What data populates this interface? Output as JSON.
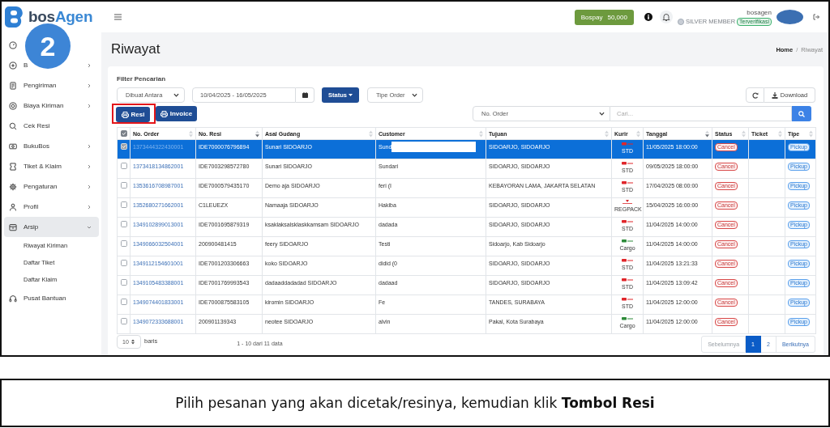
{
  "step_badge": "2",
  "header": {
    "brand": [
      "bos",
      "Agen"
    ],
    "wallet": {
      "label": "Bospay",
      "amount": "50,000"
    },
    "user": {
      "name": "bosagen",
      "tier": "SILVER MEMBER",
      "status": "Terverifikasi"
    }
  },
  "sidebar": {
    "items": [
      {
        "selected": false
      },
      {
        "label": "B",
        "expanded": false,
        "selected": false
      },
      {
        "label": "Pengiriman",
        "expanded": false,
        "selected": false
      },
      {
        "label": "Biaya Kiriman",
        "expanded": false,
        "selected": false
      },
      {
        "label": "Cek Resi",
        "selected": false
      },
      {
        "label": "BukuBos",
        "expanded": false,
        "selected": false
      },
      {
        "label": "Tiket & Klaim",
        "expanded": false,
        "selected": false
      },
      {
        "label": "Pengaturan",
        "expanded": false,
        "selected": false
      },
      {
        "label": "Profil",
        "expanded": false,
        "selected": false
      },
      {
        "label": "Arsip",
        "expanded": true,
        "selected": true,
        "children": [
          {
            "label": "Riwayat Kiriman",
            "selected": false
          },
          {
            "label": "Daftar Tiket",
            "selected": false
          },
          {
            "label": "Daftar Klaim",
            "selected": false
          }
        ]
      },
      {
        "label": "Pusat Bantuan",
        "selected": false
      }
    ]
  },
  "page": {
    "title": "Riwayat",
    "breadcrumb": {
      "separator": "/",
      "items": [
        {
          "label": "Home",
          "kind": "link"
        },
        {
          "label": "Riwayat",
          "kind": "current"
        }
      ]
    }
  },
  "filters": {
    "title": "Filter Pencarian",
    "date_basis": "Dibuat Antara",
    "date_range": "10/04/2025 - 16/05/2025",
    "status_button": "Status",
    "order_type": "Tipe Order",
    "download": "Download"
  },
  "print_buttons": [
    {
      "label": "Resi",
      "highlighted": true
    },
    {
      "label": "Invoice",
      "highlighted": false
    }
  ],
  "search": {
    "field": "No. Order",
    "placeholder": "Cari..."
  },
  "table": {
    "all_checked": true,
    "columns": [
      {
        "label": "No. Order",
        "sorted": false
      },
      {
        "label": "No. Resi",
        "sorted": true
      },
      {
        "label": "Asal Gudang",
        "sorted": false
      },
      {
        "label": "Customer",
        "sorted": false
      },
      {
        "label": "Tujuan",
        "sorted": false
      },
      {
        "label": "Kurir",
        "sorted": false
      },
      {
        "label": "Tanggal",
        "sorted": true
      },
      {
        "label": "Status",
        "sorted": false
      },
      {
        "label": "Ticket",
        "sorted": false
      },
      {
        "label": "Tipe",
        "sorted": false
      }
    ],
    "rows": [
      {
        "selected": true,
        "checked": true,
        "order_no": "1373444322430001",
        "resi": "IDE7000076796894",
        "origin": "Sunari SIDOARJO",
        "customer": {
          "text": "Sund",
          "redacted": true
        },
        "destination": "SIDOARJO, SIDOARJO",
        "courier": {
          "kind": "redline",
          "service": "STD"
        },
        "date": "11/05/2025 18:00:00",
        "status": "Cancel",
        "type": "Pickup"
      },
      {
        "selected": false,
        "checked": false,
        "order_no": "1373418134862001",
        "resi": "IDE7003298572780",
        "origin": "Sunari SIDOARJO",
        "customer": {
          "text": "Sundari",
          "redacted": false
        },
        "destination": "SIDOARJO, SIDOARJO",
        "courier": {
          "kind": "redline",
          "service": "STD"
        },
        "date": "09/05/2025 18:00:00",
        "status": "Cancel",
        "type": "Pickup"
      },
      {
        "selected": false,
        "checked": false,
        "order_no": "1353616708987001",
        "resi": "IDE7000579435170",
        "origin": "Demo aja SIDOARJO",
        "customer": {
          "text": "feri (I",
          "redacted": false
        },
        "destination": "KEBAYORAN LAMA, JAKARTA SELATAN",
        "courier": {
          "kind": "redline",
          "service": "STD"
        },
        "date": "17/04/2025 08:00:00",
        "status": "Cancel",
        "type": "Pickup"
      },
      {
        "selected": false,
        "checked": false,
        "order_no": "1352680271662001",
        "resi": "C1LEUEZX",
        "origin": "Namaaja SIDOARJO",
        "customer": {
          "text": "Hakiba",
          "redacted": false
        },
        "destination": "SIDOARJO, SIDOARJO",
        "courier": {
          "kind": "redpin",
          "service": "REGPACK"
        },
        "date": "15/04/2025 16:00:00",
        "status": "Cancel",
        "type": "Pickup"
      },
      {
        "selected": false,
        "checked": false,
        "order_no": "1349102899013001",
        "resi": "IDE7001695879319",
        "origin": "ksaklaksalsklaskkamsam SIDOARJO",
        "customer": {
          "text": "dadada",
          "redacted": false
        },
        "destination": "SIDOARJO, SIDOARJO",
        "courier": {
          "kind": "redline",
          "service": "STD"
        },
        "date": "11/04/2025 14:00:00",
        "status": "Cancel",
        "type": "Pickup"
      },
      {
        "selected": false,
        "checked": false,
        "order_no": "1349066032504001",
        "resi": "200900481415",
        "origin": "feery SIDOARJO",
        "customer": {
          "text": "Testi",
          "redacted": false
        },
        "destination": "Sidoarjo, Kab Sidoarjo",
        "courier": {
          "kind": "greenline",
          "service": "Cargo"
        },
        "date": "11/04/2025 14:00:00",
        "status": "Cancel",
        "type": "Pickup"
      },
      {
        "selected": false,
        "checked": false,
        "order_no": "1349112154601001",
        "resi": "IDE7001203306663",
        "origin": "koko SIDOARJO",
        "customer": {
          "text": "didid (0",
          "redacted": false
        },
        "destination": "SIDOARJO, SIDOARJO",
        "courier": {
          "kind": "redline",
          "service": "STD"
        },
        "date": "11/04/2025 13:21:33",
        "status": "Cancel",
        "type": "Pickup"
      },
      {
        "selected": false,
        "checked": false,
        "order_no": "1349105483388001",
        "resi": "IDE7001769993543",
        "origin": "dadaaddadadad SIDOARJO",
        "customer": {
          "text": "dadaad",
          "redacted": false
        },
        "destination": "SIDOARJO, SIDOARJO",
        "courier": {
          "kind": "redline",
          "service": "STD"
        },
        "date": "11/04/2025 13:09:42",
        "status": "Cancel",
        "type": "Pickup"
      },
      {
        "selected": false,
        "checked": false,
        "order_no": "1349074401833001",
        "resi": "IDE7000875583105",
        "origin": "kiromin SIDOARJO",
        "customer": {
          "text": "Fe",
          "redacted": false
        },
        "destination": "TANDES, SURABAYA",
        "courier": {
          "kind": "redline",
          "service": "STD"
        },
        "date": "11/04/2025 12:00:00",
        "status": "Cancel",
        "type": "Pickup"
      },
      {
        "selected": false,
        "checked": false,
        "order_no": "1349072333688001",
        "resi": "200901139343",
        "origin": "neotee SIDOARJO",
        "customer": {
          "text": "alvin",
          "redacted": false
        },
        "destination": "Pakal, Kota Surabaya",
        "courier": {
          "kind": "greenline",
          "service": "Cargo"
        },
        "date": "11/04/2025 12:00:00",
        "status": "Cancel",
        "type": "Pickup"
      }
    ]
  },
  "footer": {
    "page_size": "10",
    "page_size_label": "baris",
    "info": "1 - 10 dari 11 data",
    "pages": [
      {
        "label": "Sebelumnya",
        "selected": false,
        "disabled": true
      },
      {
        "label": "1",
        "selected": true,
        "disabled": false
      },
      {
        "label": "2",
        "selected": false,
        "disabled": false
      },
      {
        "label": "Berikutnya",
        "selected": false,
        "disabled": false
      }
    ]
  },
  "caption": "Pilih pesanan yang akan dicetak/resinya, kemudian klik **Tombol Resi**"
}
